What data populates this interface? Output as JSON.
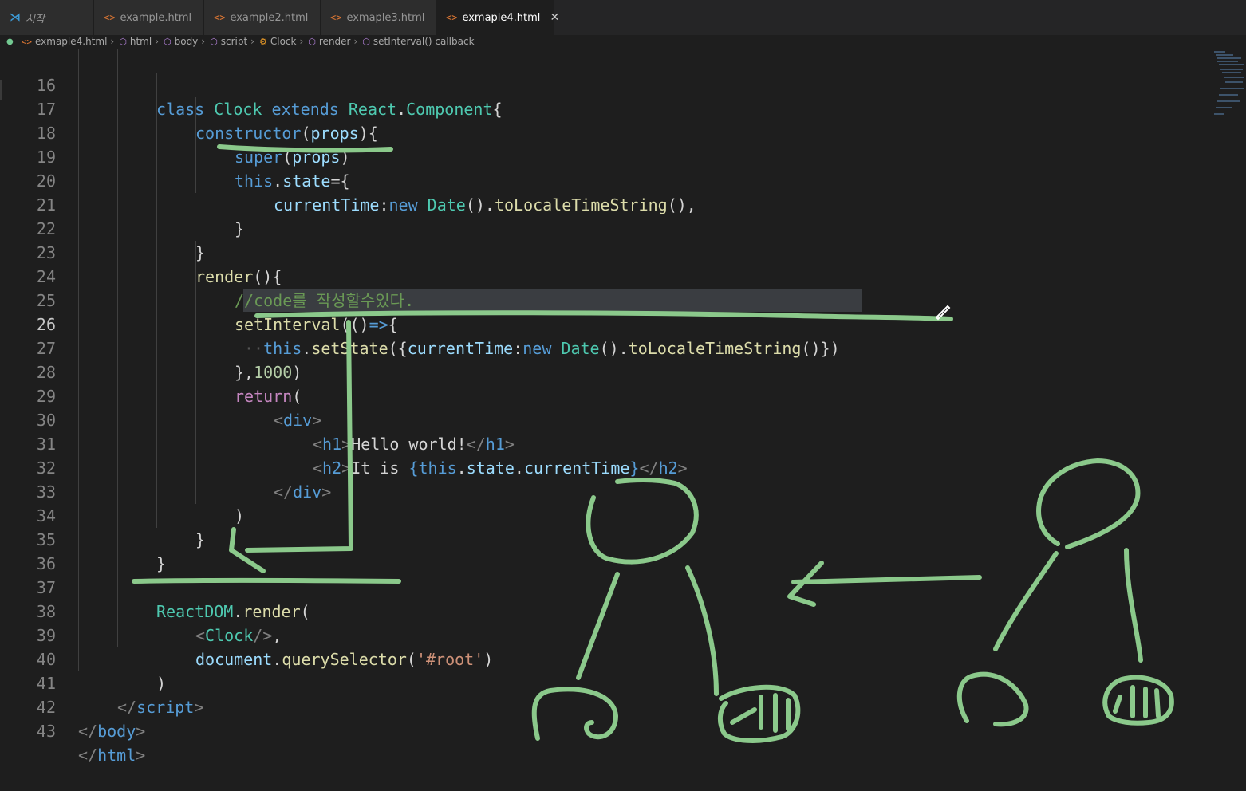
{
  "tabs": [
    {
      "label": "시작",
      "icon": "vscode-logo-icon",
      "active": false
    },
    {
      "label": "example.html",
      "icon": "html-file-icon",
      "active": false
    },
    {
      "label": "example2.html",
      "icon": "html-file-icon",
      "active": false
    },
    {
      "label": "exmaple3.html",
      "icon": "html-file-icon",
      "active": false
    },
    {
      "label": "exmaple4.html",
      "icon": "html-file-icon",
      "active": true,
      "close": "✕"
    }
  ],
  "breadcrumb": [
    {
      "label": "exmaple4.html",
      "icon": "html-file-icon"
    },
    {
      "label": "html",
      "icon": "cube-icon"
    },
    {
      "label": "body",
      "icon": "cube-icon"
    },
    {
      "label": "script",
      "icon": "cube-icon"
    },
    {
      "label": "Clock",
      "icon": "class-icon"
    },
    {
      "label": "render",
      "icon": "cube-icon"
    },
    {
      "label": "setInterval() callback",
      "icon": "cube-icon"
    }
  ],
  "editor": {
    "line_numbers": [
      "16",
      "17",
      "18",
      "19",
      "20",
      "21",
      "22",
      "23",
      "24",
      "25",
      "26",
      "27",
      "28",
      "29",
      "30",
      "31",
      "32",
      "33",
      "34",
      "35",
      "36",
      "37",
      "38",
      "39",
      "40",
      "41",
      "42",
      "43"
    ],
    "current_line": "26",
    "colors": {
      "keyword": "#569cd6",
      "type": "#4ec9b0",
      "function": "#dcdcaa",
      "variable": "#9cdcfe",
      "comment": "#6a9955",
      "string": "#ce9178",
      "number": "#b5cea8",
      "annotation": "#8bc98b"
    }
  },
  "code": {
    "l16": {
      "class": "class",
      "name": "Clock",
      "extends": "extends",
      "react": "React",
      "component": "Component"
    },
    "l17": {
      "ctor": "constructor",
      "props": "props"
    },
    "l18": {
      "super": "super",
      "props": "props"
    },
    "l19": {
      "this": "this",
      "state": "state"
    },
    "l20": {
      "key": "currentTime",
      "new": "new",
      "date": "Date",
      "fn": "toLocaleTimeString"
    },
    "l23": {
      "render": "render"
    },
    "l24": {
      "comment": "//code를 작성할수있다."
    },
    "l25": {
      "fn": "setInterval"
    },
    "l26": {
      "ws": "··",
      "this": "this",
      "fn": "setState",
      "key": "currentTime",
      "new": "new",
      "date": "Date",
      "fn2": "toLocaleTimeString"
    },
    "l27": {
      "num": "1000"
    },
    "l28": {
      "ret": "return"
    },
    "l29": {
      "tag": "div"
    },
    "l30": {
      "tag": "h1",
      "text": "Hello world!"
    },
    "l31": {
      "tag": "h2",
      "text": "It is ",
      "this": "this",
      "state": "state",
      "prop": "currentTime"
    },
    "l32": {
      "tag": "div"
    },
    "l37": {
      "obj": "ReactDOM",
      "fn": "render"
    },
    "l38": {
      "tag": "Clock"
    },
    "l39": {
      "obj": "document",
      "fn": "querySelector",
      "str": "'#root'"
    },
    "l41": {
      "tag": "script"
    },
    "l42": {
      "tag": "body"
    },
    "l43": {
      "tag": "html"
    }
  }
}
